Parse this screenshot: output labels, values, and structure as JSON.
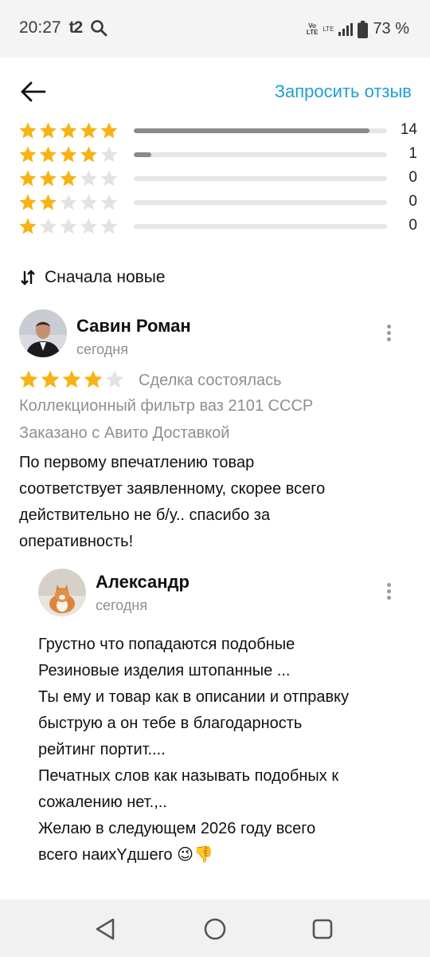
{
  "status_bar": {
    "time": "20:27",
    "carrier": "t2",
    "battery_text": "73 %",
    "volte_tag_top": "Vo",
    "volte_tag_bottom": "LTE",
    "lte_tag": "LTE"
  },
  "toolbar": {
    "back_icon": "arrow-left-icon",
    "request_review_label": "Запросить отзыв"
  },
  "rating_summary": {
    "star_color": "#f7b314",
    "empty_star_color": "#e3e3e3",
    "rows": [
      {
        "stars": 5,
        "count": "14",
        "fill_fraction": 0.93
      },
      {
        "stars": 4,
        "count": "1",
        "fill_fraction": 0.07
      },
      {
        "stars": 3,
        "count": "0",
        "fill_fraction": 0
      },
      {
        "stars": 2,
        "count": "0",
        "fill_fraction": 0
      },
      {
        "stars": 1,
        "count": "0",
        "fill_fraction": 0
      }
    ]
  },
  "sort": {
    "icon": "sort-arrows-icon",
    "label": "Сначала новые"
  },
  "review": {
    "author": "Савин Роман",
    "date": "сегодня",
    "rating": 4,
    "deal_status": "Сделка состоялась",
    "item_title": "Коллекционный фильтр ваз 2101 СССР",
    "delivery": "Заказано с Авито Доставкой",
    "text_lines": [
      "По первому впечатлению товар",
      "соответствует заявленному, скорее всего",
      "действительно не б/у.. спасибо за",
      "оперативность!"
    ]
  },
  "reply": {
    "author": "Александр",
    "date": "сегодня",
    "text_lines": [
      "Грустно что попадаются подобные",
      "Резиновые изделия штопанные ...",
      "Ты ему и товар как в описании и отправку",
      "быструю а он тебе в благодарность",
      "рейтинг портит....",
      "Печатных слов как называть подобных к",
      "сожалению нет.,..",
      "Желаю в следующем 2026 году всего",
      "всего наиxYдшего 😉👎"
    ]
  },
  "nav_bar": {
    "back_icon": "triangle-back-icon",
    "home_icon": "circle-home-icon",
    "recents_icon": "square-recents-icon"
  }
}
